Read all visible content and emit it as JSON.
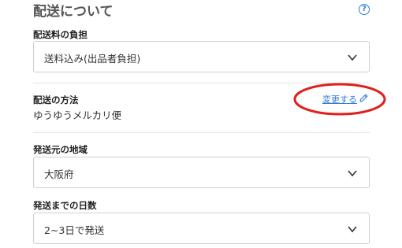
{
  "header": {
    "title": "配送について",
    "help_icon": "question-circle-icon"
  },
  "shipping_fee": {
    "label": "配送料の負担",
    "value": "送料込み(出品者負担)"
  },
  "shipping_method": {
    "label": "配送の方法",
    "value": "ゆうゆうメルカリ便",
    "change_label": "変更する",
    "change_icon": "pencil-icon"
  },
  "origin_region": {
    "label": "発送元の地域",
    "value": "大阪府"
  },
  "days_to_ship": {
    "label": "発送までの日数",
    "value": "2~3日で発送"
  },
  "colors": {
    "accent": "#2f7bd6",
    "annotation": "#e0201b"
  }
}
